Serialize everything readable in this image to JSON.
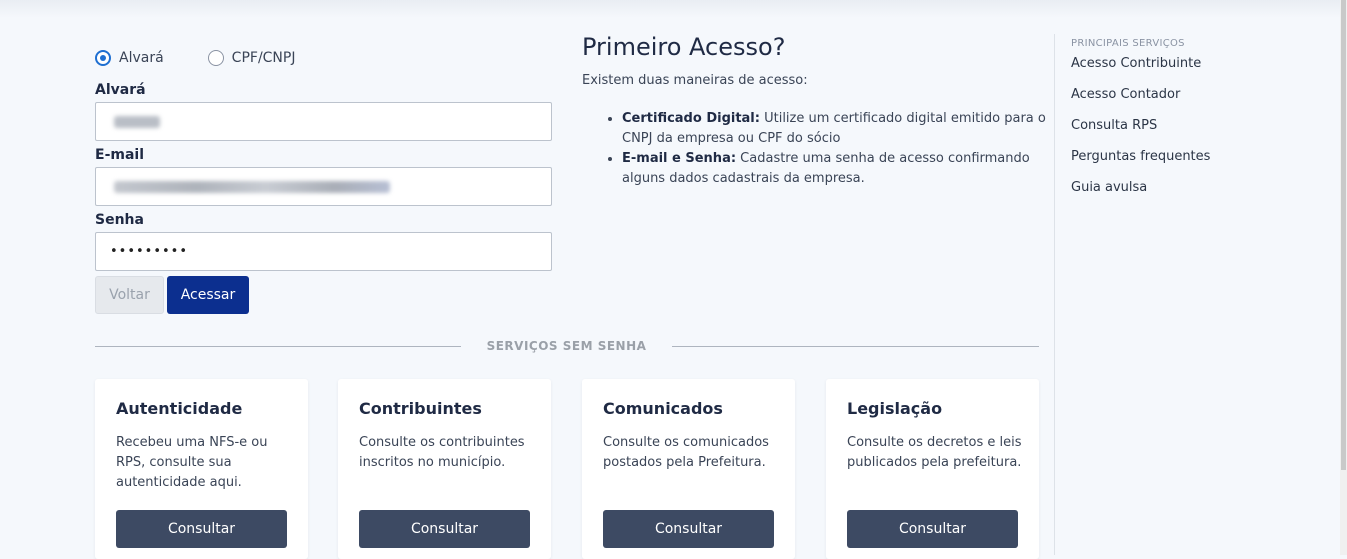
{
  "login": {
    "radio_alvara": "Alvará",
    "radio_cpf": "CPF/CNPJ",
    "label_alvara": "Alvará",
    "label_email": "E-mail",
    "label_senha": "Senha",
    "senha_value": "•••••••••",
    "btn_voltar": "Voltar",
    "btn_acessar": "Acessar"
  },
  "primeiro_acesso": {
    "title": "Primeiro Acesso?",
    "intro": "Existem duas maneiras de acesso:",
    "items": [
      {
        "strong": "Certificado Digital:",
        "text": " Utilize um certificado digital emitido para o CNPJ da empresa ou CPF do sócio"
      },
      {
        "strong": "E-mail e Senha:",
        "text": " Cadastre uma senha de acesso confirmando alguns dados cadastrais da empresa."
      }
    ]
  },
  "sidebar": {
    "title": "PRINCIPAIS SERVIÇOS",
    "items": [
      "Acesso Contribuinte",
      "Acesso Contador",
      "Consulta RPS",
      "Perguntas frequentes",
      "Guia avulsa"
    ]
  },
  "divider": "SERVIÇOS SEM SENHA",
  "cards": [
    {
      "title": "Autenticidade",
      "text": "Recebeu uma NFS-e ou RPS, consulte sua autenticidade aqui.",
      "button": "Consultar"
    },
    {
      "title": "Contribuintes",
      "text": "Consulte os contribuintes inscritos no município.",
      "button": "Consultar"
    },
    {
      "title": "Comunicados",
      "text": "Consulte os comunicados postados pela Prefeitura.",
      "button": "Consultar"
    },
    {
      "title": "Legislação",
      "text": "Consulte os decretos e leis publicados pela prefeitura.",
      "button": "Consultar"
    }
  ]
}
